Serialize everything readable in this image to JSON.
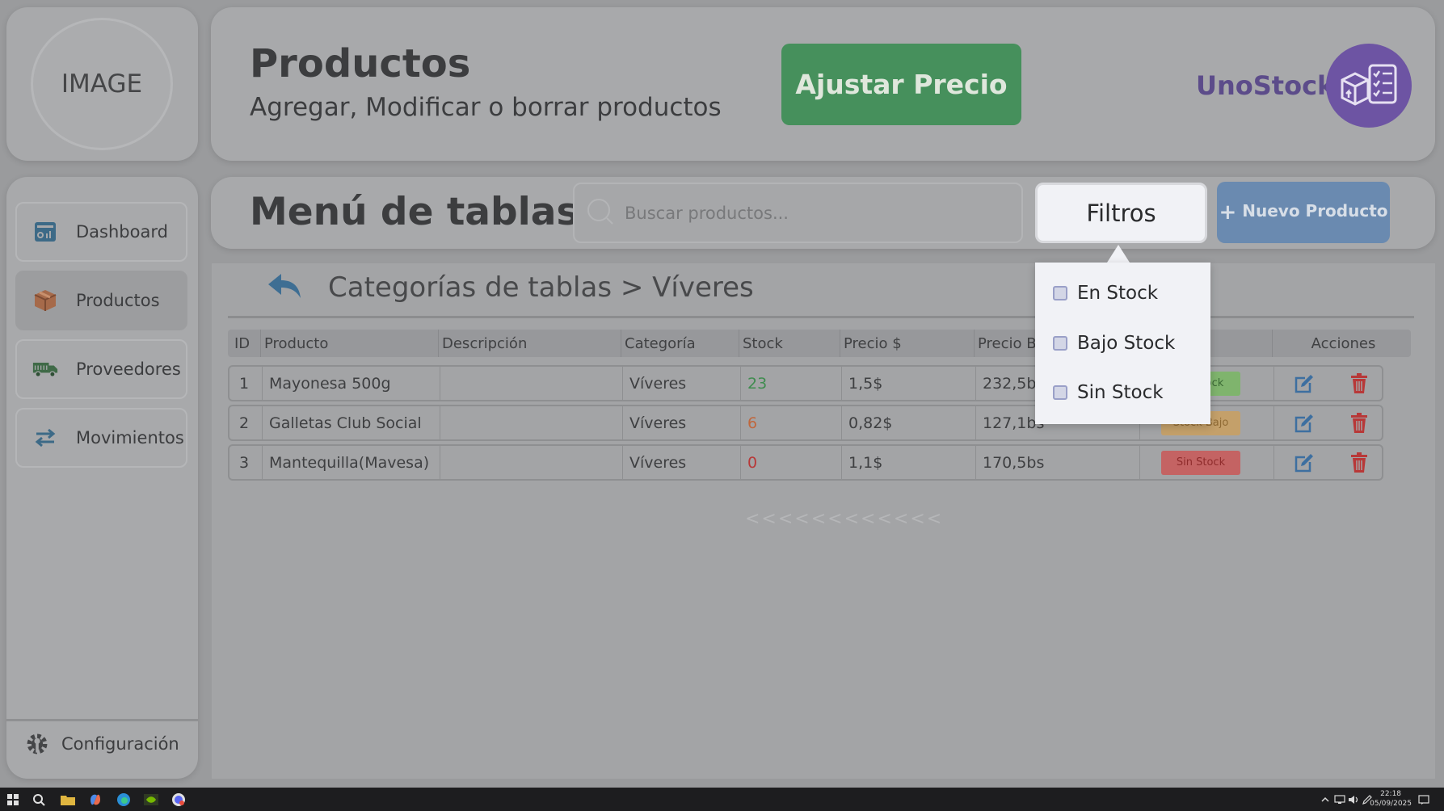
{
  "logo": {
    "placeholder": "IMAGE"
  },
  "header": {
    "title": "Productos",
    "subtitle": "Agregar, Modificar o borrar productos",
    "adjust_price_label": "Ajustar Precio",
    "brand_name": "UnoStock"
  },
  "sidebar": {
    "items": [
      {
        "label": "Dashboard",
        "icon": "dashboard-icon"
      },
      {
        "label": "Productos",
        "icon": "box-icon"
      },
      {
        "label": "Proveedores",
        "icon": "truck-icon"
      },
      {
        "label": "Movimientos",
        "icon": "transfer-arrows-icon"
      }
    ],
    "config_label": "Configuración"
  },
  "menu": {
    "title": "Menú de tablas",
    "search_placeholder": "Buscar productos...",
    "filters_label": "Filtros",
    "new_product_label": "Nuevo Producto"
  },
  "breadcrumb": "Categorías de tablas > Víveres",
  "table": {
    "headers": [
      "ID",
      "Producto",
      "Descripción",
      "Categoría",
      "Stock",
      "Precio $",
      "Precio B",
      "",
      "Acciones"
    ],
    "rows": [
      {
        "id": "1",
        "product": "Mayonesa 500g",
        "description": "",
        "category": "Víveres",
        "stock": "23",
        "price_usd": "1,5$",
        "price_bs": "232,5bs",
        "status": "En Stock"
      },
      {
        "id": "2",
        "product": "Galletas Club Social",
        "description": "",
        "category": "Víveres",
        "stock": "6",
        "price_usd": "0,82$",
        "price_bs": "127,1bs",
        "status": "Stock Bajo"
      },
      {
        "id": "3",
        "product": "Mantequilla(Mavesa)",
        "description": "",
        "category": "Víveres",
        "stock": "0",
        "price_usd": "1,1$",
        "price_bs": "170,5bs",
        "status": "Sin Stock"
      }
    ]
  },
  "scroll_indicator": "<<<<<<<<<<<<",
  "filters": {
    "options": [
      "En Stock",
      "Bajo Stock",
      "Sin Stock"
    ]
  },
  "taskbar": {
    "time": "22:18",
    "date": "05/09/2025"
  },
  "colors": {
    "accent_green": "#46905c",
    "accent_blue": "#6a8ab0",
    "brand_purple": "#6d54a3",
    "danger_red": "#b83838"
  }
}
